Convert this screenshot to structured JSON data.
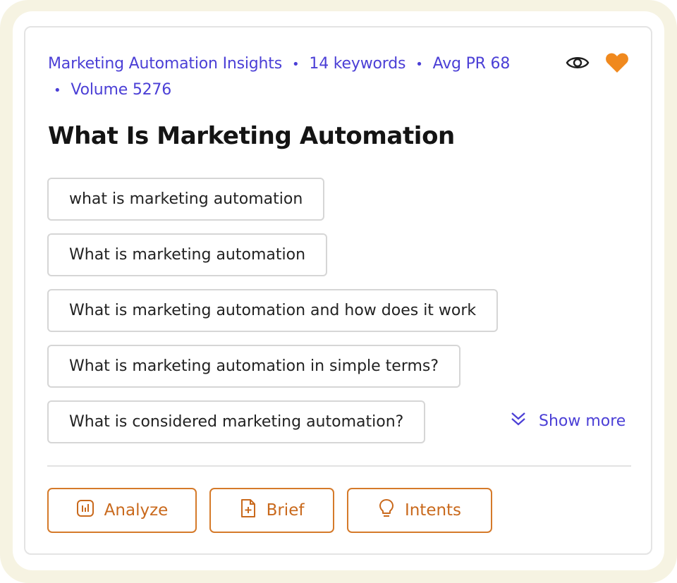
{
  "header": {
    "category": "Marketing Automation Insights",
    "keywords": "14 keywords",
    "avg_pr": "Avg PR 68",
    "volume": "Volume 5276",
    "separator": "•"
  },
  "icons": {
    "watch": "eye-icon",
    "favorite": "heart-icon",
    "favorite_color": "#f0891e"
  },
  "title": "What Is Marketing Automation",
  "keywords": [
    "what is marketing automation",
    "What is marketing automation",
    "What is marketing automation and how does it work",
    "What is marketing automation in simple terms?",
    "What is considered marketing automation?"
  ],
  "show_more": "Show more",
  "actions": {
    "analyze": "Analyze",
    "brief": "Brief",
    "intents": "Intents"
  },
  "colors": {
    "accent": "#4b3fd6",
    "action": "#c9691c",
    "frame": "#f6f3e2"
  }
}
